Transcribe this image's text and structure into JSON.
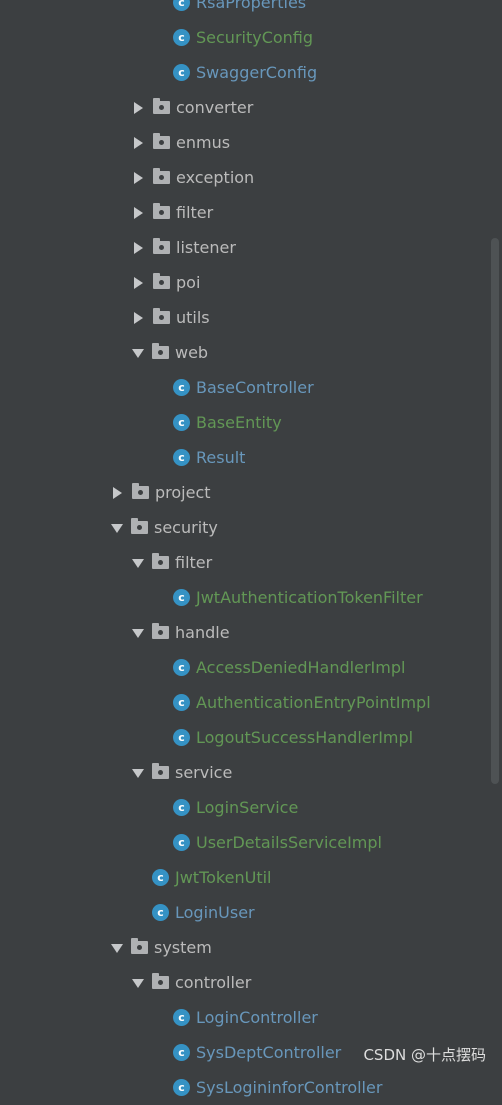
{
  "tree": [
    {
      "label": "RsaProperties",
      "kind": "class",
      "color": "blue",
      "expanded": false
    },
    {
      "label": "SecurityConfig",
      "kind": "class",
      "color": "green",
      "expanded": false
    },
    {
      "label": "SwaggerConfig",
      "kind": "class",
      "color": "blue",
      "expanded": false
    },
    {
      "label": "converter",
      "kind": "folder",
      "expanded": false
    },
    {
      "label": "enmus",
      "kind": "folder",
      "expanded": false
    },
    {
      "label": "exception",
      "kind": "folder",
      "expanded": false
    },
    {
      "label": "filter",
      "kind": "folder",
      "expanded": false
    },
    {
      "label": "listener",
      "kind": "folder",
      "expanded": false
    },
    {
      "label": "poi",
      "kind": "folder",
      "expanded": false
    },
    {
      "label": "utils",
      "kind": "folder",
      "expanded": false
    },
    {
      "label": "web",
      "kind": "folder",
      "expanded": true
    },
    {
      "label": "BaseController",
      "kind": "class",
      "color": "blue",
      "expanded": false
    },
    {
      "label": "BaseEntity",
      "kind": "class",
      "color": "green",
      "expanded": false
    },
    {
      "label": "Result",
      "kind": "class",
      "color": "blue",
      "expanded": false
    },
    {
      "label": "project",
      "kind": "folder",
      "expanded": false
    },
    {
      "label": "security",
      "kind": "folder",
      "expanded": true
    },
    {
      "label": "filter",
      "kind": "folder",
      "expanded": true
    },
    {
      "label": "JwtAuthenticationTokenFilter",
      "kind": "class",
      "color": "green",
      "expanded": false
    },
    {
      "label": "handle",
      "kind": "folder",
      "expanded": true
    },
    {
      "label": "AccessDeniedHandlerImpl",
      "kind": "class",
      "color": "green",
      "expanded": false
    },
    {
      "label": "AuthenticationEntryPointImpl",
      "kind": "class",
      "color": "green",
      "expanded": false
    },
    {
      "label": "LogoutSuccessHandlerImpl",
      "kind": "class",
      "color": "green",
      "expanded": false
    },
    {
      "label": "service",
      "kind": "folder",
      "expanded": true
    },
    {
      "label": "LoginService",
      "kind": "class",
      "color": "green",
      "expanded": false
    },
    {
      "label": "UserDetailsServiceImpl",
      "kind": "class",
      "color": "green",
      "expanded": false
    },
    {
      "label": "JwtTokenUtil",
      "kind": "class",
      "color": "green",
      "expanded": false
    },
    {
      "label": "LoginUser",
      "kind": "class",
      "color": "blue",
      "expanded": false
    },
    {
      "label": "system",
      "kind": "folder",
      "expanded": true
    },
    {
      "label": "controller",
      "kind": "folder",
      "expanded": true
    },
    {
      "label": "LoginController",
      "kind": "class",
      "color": "blue",
      "expanded": false
    },
    {
      "label": "SysDeptController",
      "kind": "class",
      "color": "blue",
      "expanded": false
    },
    {
      "label": "SysLogininforController",
      "kind": "class",
      "color": "blue",
      "expanded": false
    }
  ],
  "class_icon_letter": "c",
  "watermark": "CSDN @十点摆码",
  "colors": {
    "background": "#3c3f41",
    "folder_text": "#bbbbbb",
    "class_green": "#629755",
    "class_blue": "#6897bb",
    "class_icon": "#3592c4"
  }
}
